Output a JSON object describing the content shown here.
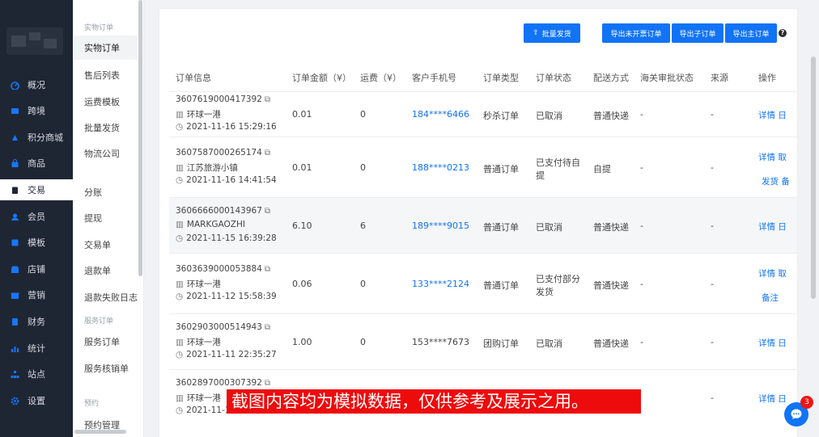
{
  "colors": {
    "accent": "#1173f5",
    "nav_bg": "#1f2633",
    "notice_bg": "#ee0b0b",
    "badge": "#f01414"
  },
  "nav": {
    "items": [
      {
        "label": "概况",
        "icon": "dashboard-icon"
      },
      {
        "label": "跨境",
        "icon": "globe-icon"
      },
      {
        "label": "积分商城",
        "icon": "points-icon"
      },
      {
        "label": "商品",
        "icon": "bag-icon"
      },
      {
        "label": "交易",
        "icon": "clipboard-icon",
        "active": true
      },
      {
        "label": "会员",
        "icon": "member-icon"
      },
      {
        "label": "模板",
        "icon": "template-icon"
      },
      {
        "label": "店铺",
        "icon": "store-icon"
      },
      {
        "label": "营销",
        "icon": "gift-icon"
      },
      {
        "label": "财务",
        "icon": "finance-icon"
      },
      {
        "label": "统计",
        "icon": "chart-icon"
      },
      {
        "label": "站点",
        "icon": "sitemap-icon"
      },
      {
        "label": "设置",
        "icon": "gear-icon"
      }
    ]
  },
  "sub": {
    "group1": "实物订单",
    "items1": [
      "实物订单",
      "售后列表",
      "运费模板",
      "批量发货",
      "物流公司"
    ],
    "items2": [
      "分账",
      "提现",
      "交易单",
      "退款单",
      "退款失败日志"
    ],
    "group2": "服务订单",
    "items3": [
      "服务订单",
      "服务核销单"
    ],
    "group3": "预约",
    "items4": [
      "预约管理"
    ]
  },
  "toolbar": {
    "batch_ship": "批量发货",
    "export_uninvoiced": "导出未开票订单",
    "export_sub": "导出子订单",
    "export_main": "导出主订单",
    "help": "?"
  },
  "table": {
    "headers": [
      "订单信息",
      "订单金额（¥）",
      "运费（¥）",
      "客户手机号",
      "订单类型",
      "订单状态",
      "配送方式",
      "海关审批状态",
      "来源",
      "操作"
    ],
    "rows": [
      {
        "id": "3607619000417392",
        "shop": "环球一港",
        "time": "2021-11-16 15:29:16",
        "amount": "0.01",
        "freight": "0",
        "phone": "184****6466",
        "phone_link": true,
        "type": "秒杀订单",
        "status": [
          "已取消"
        ],
        "delivery": "普通快递",
        "customs": "-",
        "source": "-",
        "actions": [
          "详情 日"
        ]
      },
      {
        "id": "3607587000265174",
        "shop": "江苏旅游小镇",
        "time": "2021-11-16 14:41:54",
        "amount": "0.01",
        "freight": "0",
        "phone": "188****0213",
        "phone_link": true,
        "type": "普通订单",
        "status": [
          "已支付待自",
          "提"
        ],
        "delivery": "自提",
        "customs": "-",
        "source": "-",
        "actions": [
          "详情 取",
          "发货 备"
        ]
      },
      {
        "id": "3606666000143967",
        "shop": "MARKGAOZHI",
        "time": "2021-11-15 16:39:28",
        "amount": "6.10",
        "freight": "6",
        "phone": "189****9015",
        "phone_link": true,
        "type": "普通订单",
        "status": [
          "已取消"
        ],
        "delivery": "普通快递",
        "customs": "-",
        "source": "-",
        "actions": [
          "详情 日"
        ]
      },
      {
        "id": "3603639000053884",
        "shop": "环球一港",
        "time": "2021-11-12 15:58:39",
        "amount": "0.06",
        "freight": "0",
        "phone": "133****2124",
        "phone_link": true,
        "type": "普通订单",
        "status": [
          "已支付部分",
          "发货"
        ],
        "delivery": "普通快递",
        "customs": "-",
        "source": "-",
        "actions": [
          "详情 取",
          "备注"
        ]
      },
      {
        "id": "3602903000514943",
        "shop": "环球一港",
        "time": "2021-11-11 22:35:27",
        "amount": "1.00",
        "freight": "0",
        "phone": "153****7673",
        "phone_link": false,
        "type": "团购订单",
        "status": [
          "已取消"
        ],
        "delivery": "普通快递",
        "customs": "-",
        "source": "-",
        "actions": [
          "详情 日"
        ]
      },
      {
        "id": "3602897000307392",
        "shop": "环球一港",
        "time": "2021-11-11",
        "amount": "",
        "freight": "",
        "phone": "",
        "phone_link": false,
        "type": "",
        "status": [
          ""
        ],
        "delivery": "",
        "customs": "",
        "source": "-",
        "actions": [
          "详情 日"
        ]
      }
    ]
  },
  "notice": "截图内容均为模拟数据，仅供参考及展示之用。",
  "chat": {
    "badge": "3"
  }
}
